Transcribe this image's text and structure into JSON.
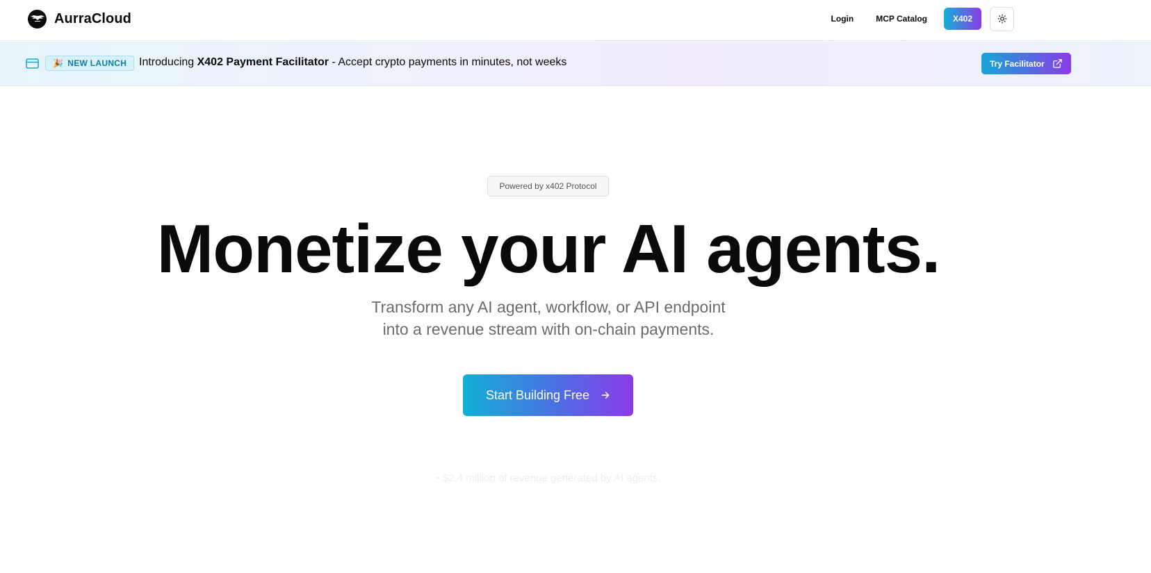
{
  "header": {
    "brand_name": "AurraCloud",
    "nav": {
      "login": "Login",
      "mcp_catalog": "MCP Catalog",
      "x402": "X402"
    },
    "theme_icon": "sun-icon"
  },
  "banner": {
    "icon": "credit-card-icon",
    "badge_emoji": "🎉",
    "badge_label": "NEW LAUNCH",
    "text_prefix": "Introducing ",
    "text_bold": "X402 Payment Facilitator",
    "text_suffix": " - Accept crypto payments in minutes, not weeks",
    "cta_label": "Try Facilitator",
    "cta_icon": "external-link-icon"
  },
  "hero": {
    "powered_by": "Powered by x402 Protocol",
    "headline": "Monetize your AI agents.",
    "subline_1": "Transform any AI agent, workflow, or API endpoint",
    "subline_2": "into a revenue stream with on-chain payments.",
    "cta_label": "Start Building Free",
    "cta_icon": "arrow-right-icon",
    "stat": "• $2.4 million of revenue generated by AI agents."
  },
  "colors": {
    "gradient_start": "#14b0d6",
    "gradient_end": "#8b3be8",
    "badge_text": "#0b7f9e",
    "subtext": "#6b6b6b"
  }
}
